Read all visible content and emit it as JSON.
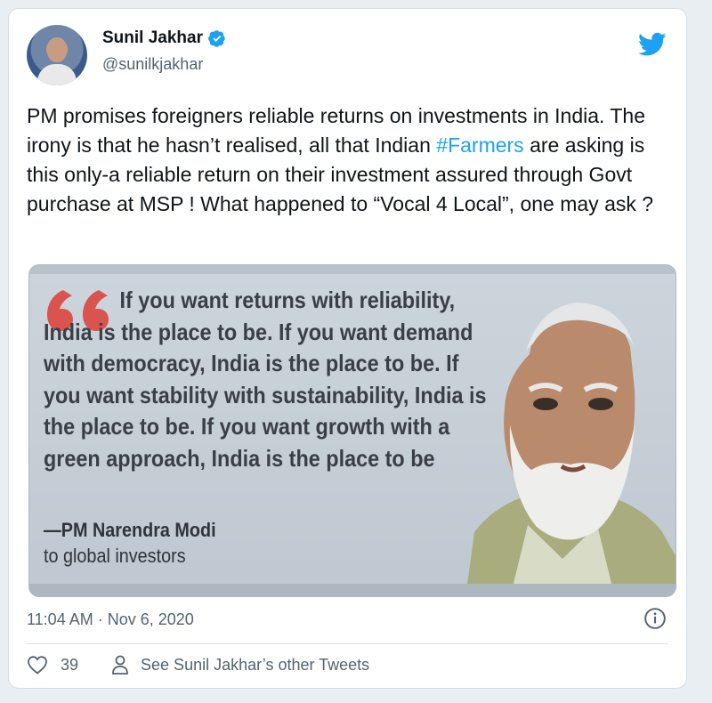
{
  "tweet": {
    "author": {
      "name": "Sunil Jakhar",
      "handle": "@sunilkjakhar"
    },
    "text_parts": {
      "before_hashtag": "PM promises foreigners reliable returns on investments in India. The irony is that he hasn’t realised, all that Indian ",
      "hashtag": "#Farmers",
      "after_hashtag": " are asking is this only-a reliable return on their investment assured through Govt  purchase at MSP ! What happened to “Vocal 4 Local”, one may ask ?"
    },
    "media": {
      "quote": "If you want returns with reliability, India is the place to be. If you want demand with democracy, India is the place to be. If you want stability with sustainability, India is the place to be. If you want growth with a green approach, India is the place to be",
      "attribution": "—PM Narendra Modi",
      "attribution_sub": "to global investors"
    },
    "timestamp": "11:04 AM · Nov 6, 2020",
    "likes": "39",
    "other_tweets_link": "See Sunil Jakhar’s other Tweets"
  },
  "colors": {
    "brand": "#1da1f2",
    "text": "#0f1419",
    "muted": "#536471",
    "quote_mark": "#d9534f"
  },
  "icons": {
    "verified": "verified-badge-icon",
    "brand": "twitter-bird-icon",
    "info": "info-icon",
    "like": "heart-icon",
    "profile": "person-icon"
  }
}
